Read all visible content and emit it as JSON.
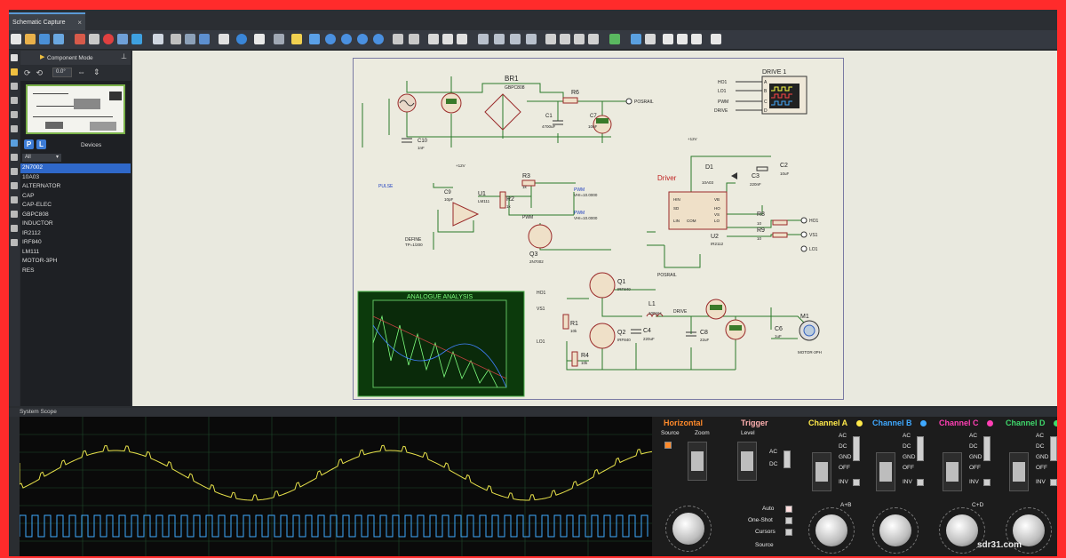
{
  "window": {
    "tab_title": "Schematic Capture",
    "tab_close": "×"
  },
  "component_panel": {
    "mode_title": "Component Mode",
    "rotation": "0.0°",
    "p_button": "P",
    "l_button": "L",
    "devices_title": "Devices",
    "filter_value": "All",
    "devices": [
      "2N7002",
      "10A03",
      "ALTERNATOR",
      "CAP",
      "CAP-ELEC",
      "GBPC808",
      "INDUCTOR",
      "IR2112",
      "IRF840",
      "LM111",
      "MOTOR-3PH",
      "RES"
    ],
    "selected_device": "2N7002"
  },
  "schematic": {
    "labels": {
      "br1": "BR1",
      "br1_part": "GBPC808",
      "r6": "R6",
      "c1": "C1",
      "c1_val": "4700uF",
      "c7": "C7",
      "c7_val": "10nF",
      "posrail": "POSRAIL",
      "c10": "C10",
      "c10_val": "1nF",
      "drive1": "DRIVE 1",
      "ho1": "HO1",
      "lo1": "LO1",
      "pwm": "PWM",
      "drive": "DRIVE",
      "pin_a": "A",
      "pin_b": "B",
      "pin_c": "C",
      "pin_d": "D",
      "v12_top": "+12V",
      "c9": "C9",
      "c9_val": "10pF",
      "u1": "U1",
      "u1_part": "LM111",
      "r3": "R3",
      "r3_val": "1k",
      "r2": "R2",
      "r2_val": "1k",
      "q3": "Q3",
      "q3_part": "2N7002",
      "pwm_label": "PWM",
      "define": "DEFINE",
      "tp_val": "TP=1/200",
      "pwm_a": "PWM",
      "pwm_a_val": "VHI=10.0000",
      "pwm_b": "PWM",
      "pwm_b_val": "VHI=10.0000",
      "pulse_text": "PULSE",
      "driver": "Driver",
      "v12_driver": "+12V",
      "d1": "D1",
      "d1_part": "10A03",
      "c3": "C3",
      "c3_val": "220nF",
      "c2": "C2",
      "c2_val": "10uF",
      "r8": "R8",
      "r8_val": "10",
      "r9": "R9",
      "r9_val": "10",
      "u2": "U2",
      "u2_part": "IR2112",
      "hin": "HIN",
      "sd": "SD",
      "lin": "LIN",
      "com": "COM",
      "vb": "VB",
      "ho": "HO",
      "vs": "VS",
      "lo": "LO",
      "out_ho1": "HO1",
      "out_vs1": "VS1",
      "out_lo1": "LO1",
      "posrail2": "POSRAIL",
      "q1": "Q1",
      "q1_part": "IRF840",
      "q2": "Q2",
      "q2_part": "IRF840",
      "l1": "L1",
      "l1_val": "100mH",
      "drive_net": "DRIVE",
      "c4": "C4",
      "c4_val": "220uF",
      "c8": "C8",
      "c8_val": "22uF",
      "c6": "C6",
      "c6_val": "1uF",
      "m1": "M1",
      "motor_part": "MOTOR-3PH",
      "r1": "R1",
      "r1_val": "10k",
      "r4": "R4",
      "r4_val": "10k",
      "in_ho1": "HO1",
      "in_vs1": "VS1",
      "in_lo1": "LO1",
      "analogue_title": "ANALOGUE ANALYSIS"
    }
  },
  "scope": {
    "title": "System Scope",
    "horizontal": "Horizontal",
    "source": "Source",
    "zoom": "Zoom",
    "trigger": "Trigger",
    "level": "Level",
    "ac": "AC",
    "dc": "DC",
    "auto": "Auto",
    "one_shot": "One-Shot",
    "cursors": "Cursors",
    "source2": "Source",
    "channel_a": "Channel A",
    "channel_b": "Channel B",
    "channel_c": "Channel C",
    "channel_d": "Channel D",
    "gnd": "GND",
    "off": "OFF",
    "inv": "INV",
    "a_plus_b": "A+B",
    "c_plus_d": "C+D",
    "colors": {
      "a": "#ffe94a",
      "b": "#3fa9ff",
      "c": "#ff3fb4",
      "d": "#3fd76b",
      "horizontal": "#ff8a2a",
      "trigger": "#ffb0b0"
    },
    "watermark": "sdr31.com"
  }
}
